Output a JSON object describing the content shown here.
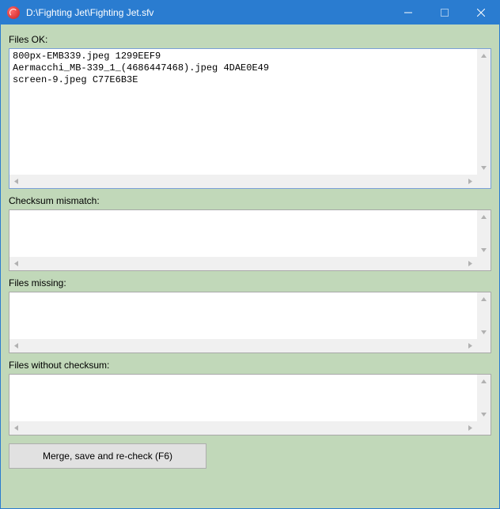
{
  "window": {
    "title": "D:\\Fighting Jet\\Fighting Jet.sfv"
  },
  "labels": {
    "files_ok": "Files OK:",
    "checksum_mismatch": "Checksum mismatch:",
    "files_missing": "Files missing:",
    "files_without_checksum": "Files without checksum:"
  },
  "data": {
    "files_ok": "800px-EMB339.jpeg 1299EEF9\nAermacchi_MB-339_1_(4686447468).jpeg 4DAE0E49\nscreen-9.jpeg C77E6B3E",
    "checksum_mismatch": "",
    "files_missing": "",
    "files_without_checksum": ""
  },
  "buttons": {
    "merge": "Merge, save and re-check (F6)"
  }
}
